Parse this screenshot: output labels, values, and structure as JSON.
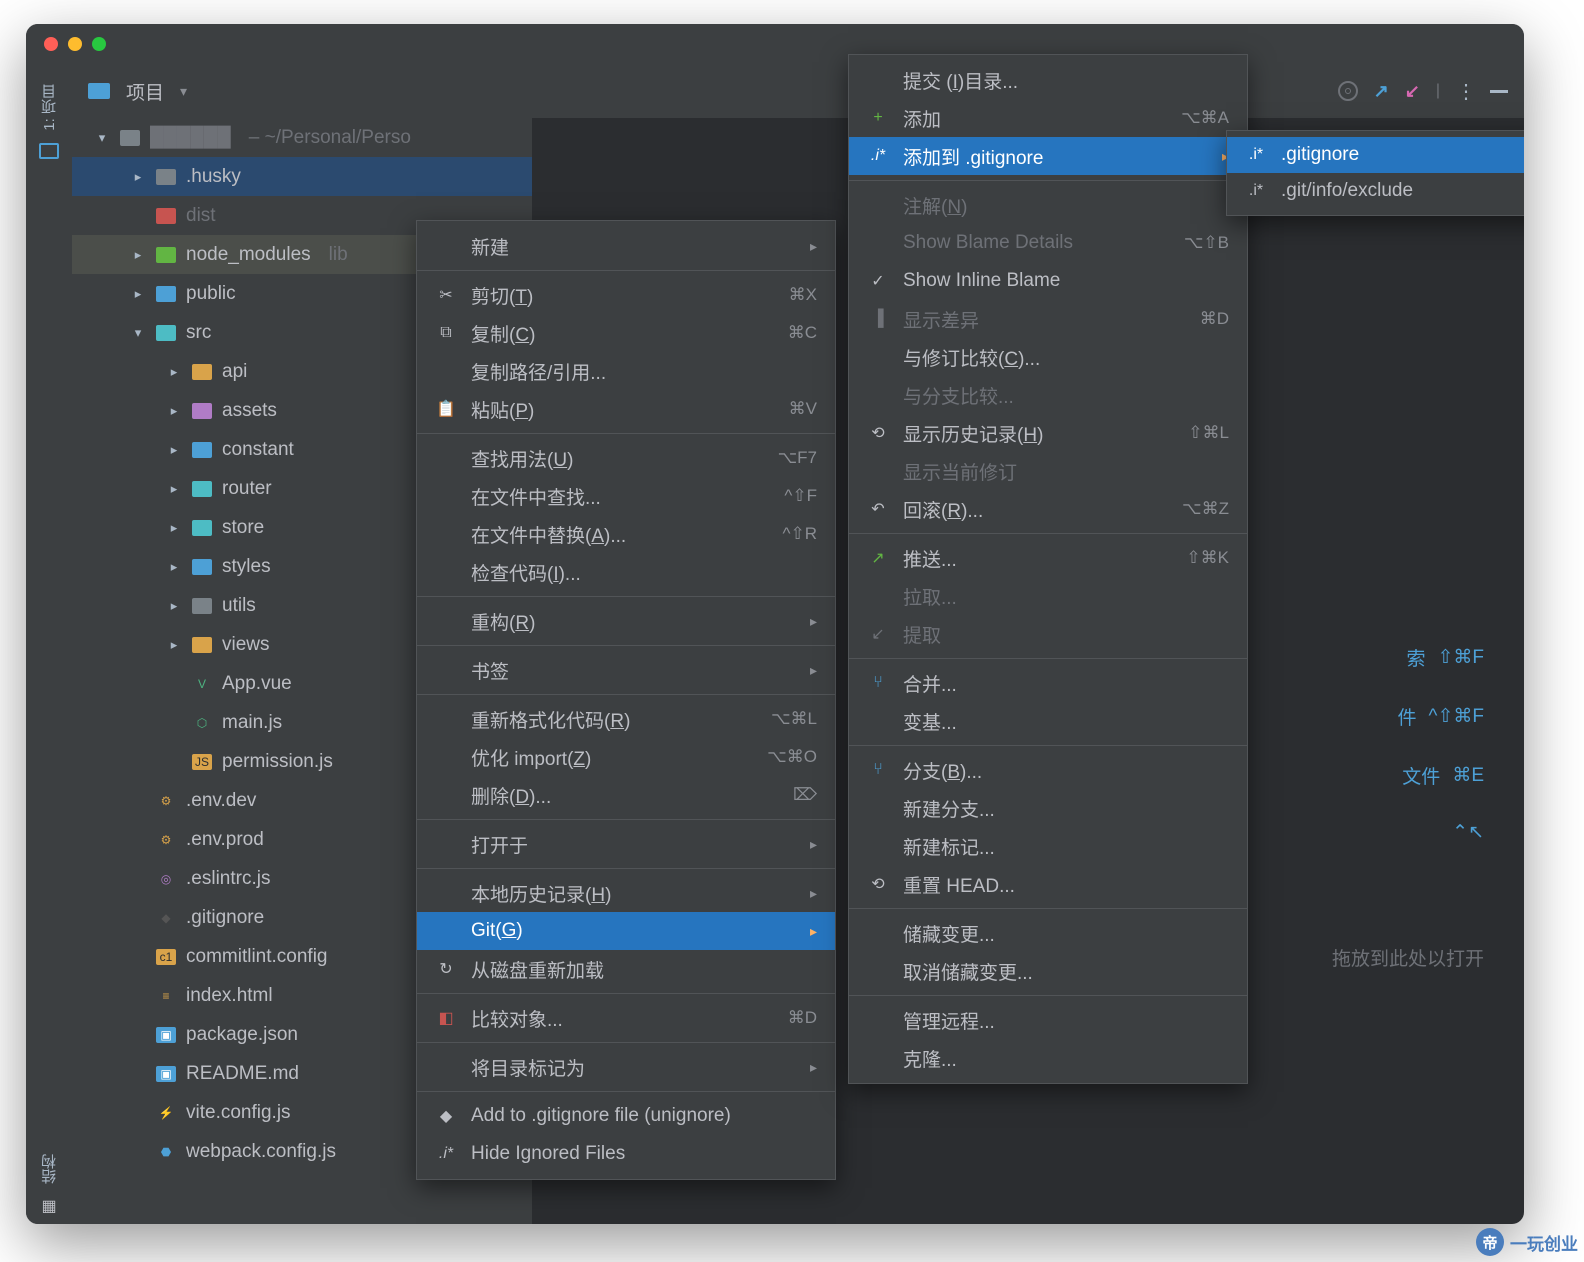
{
  "sidebar": {
    "project": "1: 项目",
    "structure": "结构"
  },
  "toolbar": {
    "project": "项目"
  },
  "tree": {
    "root_path": "~/Personal/Perso",
    "items": [
      {
        "d": 0,
        "exp": "down",
        "ico": "fld-gray",
        "text": "",
        "dim": true,
        "path": "~/Personal/Perso"
      },
      {
        "d": 1,
        "exp": "right",
        "ico": "fld-gray",
        "text": ".husky",
        "sel": true
      },
      {
        "d": 1,
        "exp": "",
        "ico": "fld-red",
        "text": "dist",
        "dim": true
      },
      {
        "d": 1,
        "exp": "right",
        "ico": "fld-green",
        "text": "node_modules",
        "suffix": "lib",
        "hov": true
      },
      {
        "d": 1,
        "exp": "right",
        "ico": "fld-blue",
        "text": "public"
      },
      {
        "d": 1,
        "exp": "down",
        "ico": "fld-cyan",
        "text": "src"
      },
      {
        "d": 2,
        "exp": "right",
        "ico": "fld-yellow",
        "text": "api"
      },
      {
        "d": 2,
        "exp": "right",
        "ico": "fld-purple",
        "text": "assets"
      },
      {
        "d": 2,
        "exp": "right",
        "ico": "fld-blue",
        "text": "constant"
      },
      {
        "d": 2,
        "exp": "right",
        "ico": "fld-cyan",
        "text": "router"
      },
      {
        "d": 2,
        "exp": "right",
        "ico": "fld-cyan",
        "text": "store"
      },
      {
        "d": 2,
        "exp": "right",
        "ico": "fld-blue",
        "text": "styles"
      },
      {
        "d": 2,
        "exp": "right",
        "ico": "fld-gray",
        "text": "utils"
      },
      {
        "d": 2,
        "exp": "right",
        "ico": "fld-yellow",
        "text": "views"
      },
      {
        "d": 2,
        "exp": "",
        "ico": "file-vue",
        "glyph": "V",
        "text": "App.vue"
      },
      {
        "d": 2,
        "exp": "",
        "ico": "file-vue",
        "glyph": "⬡",
        "text": "main.js"
      },
      {
        "d": 2,
        "exp": "",
        "ico": "file-js",
        "glyph": "JS",
        "text": "permission.js"
      },
      {
        "d": 1,
        "exp": "",
        "ico": "file-cfg",
        "glyph": "⚙",
        "text": ".env.dev"
      },
      {
        "d": 1,
        "exp": "",
        "ico": "file-cfg",
        "glyph": "⚙",
        "text": ".env.prod"
      },
      {
        "d": 1,
        "exp": "",
        "ico": "file-purple",
        "glyph": "◎",
        "text": ".eslintrc.js"
      },
      {
        "d": 1,
        "exp": "",
        "ico": "file-dark",
        "glyph": "◆",
        "text": ".gitignore"
      },
      {
        "d": 1,
        "exp": "",
        "ico": "file-js",
        "glyph": "c1",
        "text": "commitlint.config"
      },
      {
        "d": 1,
        "exp": "",
        "ico": "file-cfg",
        "glyph": "≡",
        "text": "index.html"
      },
      {
        "d": 1,
        "exp": "",
        "ico": "file-md",
        "glyph": "▣",
        "text": "package.json"
      },
      {
        "d": 1,
        "exp": "",
        "ico": "file-md",
        "glyph": "▣",
        "text": "README.md"
      },
      {
        "d": 1,
        "exp": "",
        "ico": "file-flash",
        "glyph": "⚡",
        "text": "vite.config.js"
      },
      {
        "d": 1,
        "exp": "",
        "ico": "file-wp",
        "glyph": "⬣",
        "text": "webpack.config.js"
      }
    ]
  },
  "bg": {
    "h1": "索",
    "k1": "⇧⌘F",
    "h2": "件",
    "k2": "^⇧⌘F",
    "h3": "文件",
    "k3": "⌘E",
    "k4": "⌃↖",
    "drop": "拖放到此处以打开"
  },
  "menu1": [
    {
      "label": "新建",
      "sub": true
    },
    {
      "sep": true
    },
    {
      "ico": "✂",
      "label": "剪切(T)",
      "sc": "⌘X"
    },
    {
      "ico": "⧉",
      "label": "复制(C)",
      "sc": "⌘C"
    },
    {
      "label": "复制路径/引用..."
    },
    {
      "ico": "📋",
      "label": "粘贴(P)",
      "sc": "⌘V"
    },
    {
      "sep": true
    },
    {
      "label": "查找用法(U)",
      "sc": "⌥F7"
    },
    {
      "label": "在文件中查找...",
      "sc": "^⇧F"
    },
    {
      "label": "在文件中替换(A)...",
      "sc": "^⇧R"
    },
    {
      "label": "检查代码(I)..."
    },
    {
      "sep": true
    },
    {
      "label": "重构(R)",
      "sub": true
    },
    {
      "sep": true
    },
    {
      "label": "书签",
      "sub": true
    },
    {
      "sep": true
    },
    {
      "label": "重新格式化代码(R)",
      "sc": "⌥⌘L"
    },
    {
      "label": "优化 import(Z)",
      "sc": "⌥⌘O"
    },
    {
      "label": "删除(D)...",
      "sc": "⌦"
    },
    {
      "sep": true
    },
    {
      "label": "打开于",
      "sub": true
    },
    {
      "sep": true
    },
    {
      "label": "本地历史记录(H)",
      "sub": true
    },
    {
      "label": "Git(G)",
      "sub": true,
      "hi": true
    },
    {
      "ico": "↻",
      "label": "从磁盘重新加载"
    },
    {
      "sep": true
    },
    {
      "ico": "◧",
      "label": "比较对象...",
      "sc": "⌘D",
      "icoColor": "#c75450"
    },
    {
      "sep": true
    },
    {
      "label": "将目录标记为",
      "sub": true
    },
    {
      "sep": true
    },
    {
      "ico": "◆",
      "label": "Add to .gitignore file (unignore)"
    },
    {
      "ico": ".i*",
      "label": "Hide Ignored Files",
      "ital": true
    }
  ],
  "menu2": [
    {
      "label": "提交 (I)目录..."
    },
    {
      "ico": "+",
      "label": "添加",
      "sc": "⌥⌘A",
      "icoColor": "#62b543"
    },
    {
      "ico": ".i*",
      "label": "添加到 .gitignore",
      "sub": true,
      "hi": true,
      "ital": true
    },
    {
      "sep": true
    },
    {
      "label": "注解(N)",
      "dis": true
    },
    {
      "label": "Show Blame Details",
      "sc": "⌥⇧B",
      "dis": true
    },
    {
      "ico": "✓",
      "label": "Show Inline Blame"
    },
    {
      "ico": "▐",
      "label": "显示差异",
      "sc": "⌘D",
      "dis": true
    },
    {
      "label": "与修订比较(C)..."
    },
    {
      "label": "与分支比较...",
      "dis": true
    },
    {
      "ico": "⟲",
      "label": "显示历史记录(H)",
      "sc": "⇧⌘L"
    },
    {
      "label": "显示当前修订",
      "dis": true
    },
    {
      "ico": "↶",
      "label": "回滚(R)...",
      "sc": "⌥⌘Z"
    },
    {
      "sep": true
    },
    {
      "ico": "↗",
      "label": "推送...",
      "sc": "⇧⌘K",
      "icoColor": "#62b543"
    },
    {
      "label": "拉取...",
      "dis": true
    },
    {
      "ico": "↙",
      "label": "提取",
      "dis": true
    },
    {
      "sep": true
    },
    {
      "ico": "⑂",
      "label": "合并...",
      "icoColor": "#4da0d6"
    },
    {
      "label": "变基..."
    },
    {
      "sep": true
    },
    {
      "ico": "⑂",
      "label": "分支(B)...",
      "icoColor": "#4da0d6"
    },
    {
      "label": "新建分支..."
    },
    {
      "label": "新建标记..."
    },
    {
      "ico": "⟲",
      "label": "重置 HEAD..."
    },
    {
      "sep": true
    },
    {
      "label": "储藏变更..."
    },
    {
      "label": "取消储藏变更..."
    },
    {
      "sep": true
    },
    {
      "label": "管理远程..."
    },
    {
      "label": "克隆..."
    }
  ],
  "menu3": [
    {
      "ico": ".i*",
      "label": ".gitignore",
      "hi": true
    },
    {
      "ico": ".i*",
      "label": ".git/info/exclude"
    }
  ],
  "watermark": "一玩创业"
}
